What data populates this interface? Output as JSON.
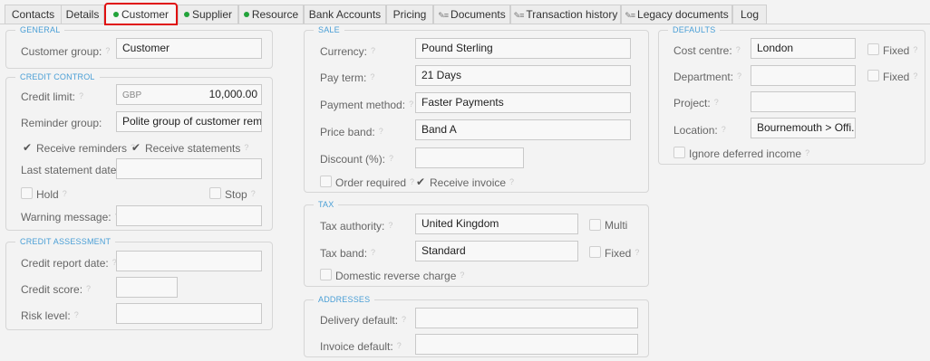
{
  "tabs": [
    "Contacts",
    "Details",
    "Customer",
    "Supplier",
    "Resource",
    "Bank Accounts",
    "Pricing",
    "Documents",
    "Transaction history",
    "Legacy documents",
    "Log"
  ],
  "general": {
    "title": "GENERAL",
    "customer_group_label": "Customer group:",
    "customer_group_value": "Customer"
  },
  "credit_control": {
    "title": "CREDIT CONTROL",
    "credit_limit_label": "Credit limit:",
    "credit_limit_currency": "GBP",
    "credit_limit_value": "10,000.00",
    "reminder_group_label": "Reminder group:",
    "reminder_group_value": "Polite group of customer rem...",
    "receive_reminders_label": "Receive reminders",
    "receive_statements_label": "Receive statements",
    "last_statement_date_label": "Last statement date:",
    "hold_label": "Hold",
    "stop_label": "Stop",
    "warning_message_label": "Warning message:"
  },
  "credit_assessment": {
    "title": "CREDIT ASSESSMENT",
    "credit_report_date_label": "Credit report date:",
    "credit_score_label": "Credit score:",
    "risk_level_label": "Risk level:"
  },
  "sale": {
    "title": "SALE",
    "currency_label": "Currency:",
    "currency_value": "Pound Sterling",
    "pay_term_label": "Pay term:",
    "pay_term_value": "21 Days",
    "payment_method_label": "Payment method:",
    "payment_method_value": "Faster Payments",
    "price_band_label": "Price band:",
    "price_band_value": "Band A",
    "discount_label": "Discount (%):",
    "order_required_label": "Order required",
    "receive_invoice_label": "Receive invoice"
  },
  "tax": {
    "title": "TAX",
    "tax_authority_label": "Tax authority:",
    "tax_authority_value": "United Kingdom",
    "multi_label": "Multi",
    "tax_band_label": "Tax band:",
    "tax_band_value": "Standard",
    "fixed_label": "Fixed",
    "domestic_reverse_label": "Domestic reverse charge"
  },
  "addresses": {
    "title": "ADDRESSES",
    "delivery_default_label": "Delivery default:",
    "invoice_default_label": "Invoice default:"
  },
  "defaults": {
    "title": "DEFAULTS",
    "cost_centre_label": "Cost centre:",
    "cost_centre_value": "London",
    "fixed_label": "Fixed",
    "department_label": "Department:",
    "project_label": "Project:",
    "location_label": "Location:",
    "location_value": "Bournemouth > Offi...",
    "ignore_deferred_label": "Ignore deferred income"
  },
  "colors": {
    "accent": "#4a9fd6",
    "active_outline": "#e01010",
    "status_dot": "#22a33a"
  },
  "icons": {
    "help": "question-mark-icon",
    "check": "check-icon",
    "document": "document-icon"
  }
}
